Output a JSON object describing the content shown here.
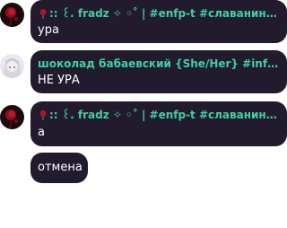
{
  "messages": [
    {
      "sender": ":: ꒰. fradz ✧ ◦˚ | #enfp-t #славаниндзя...",
      "text": "ура",
      "avatar": "rose-avatar"
    },
    {
      "sender": "шоколад бабаевский {She/Her} #infj-t #9...",
      "text": "НЕ УРА",
      "avatar": "anime-girl-avatar"
    },
    {
      "sender": ":: ꒰. fradz ✧ ◦˚ | #enfp-t #славаниндзя...",
      "text": "а",
      "avatar": "rose-avatar"
    },
    {
      "text": "отмена"
    }
  ],
  "colors": {
    "bubble": "#221b2e",
    "sender_name": "#3fcfa2",
    "text": "#ffffff",
    "background": "#ffffff"
  }
}
